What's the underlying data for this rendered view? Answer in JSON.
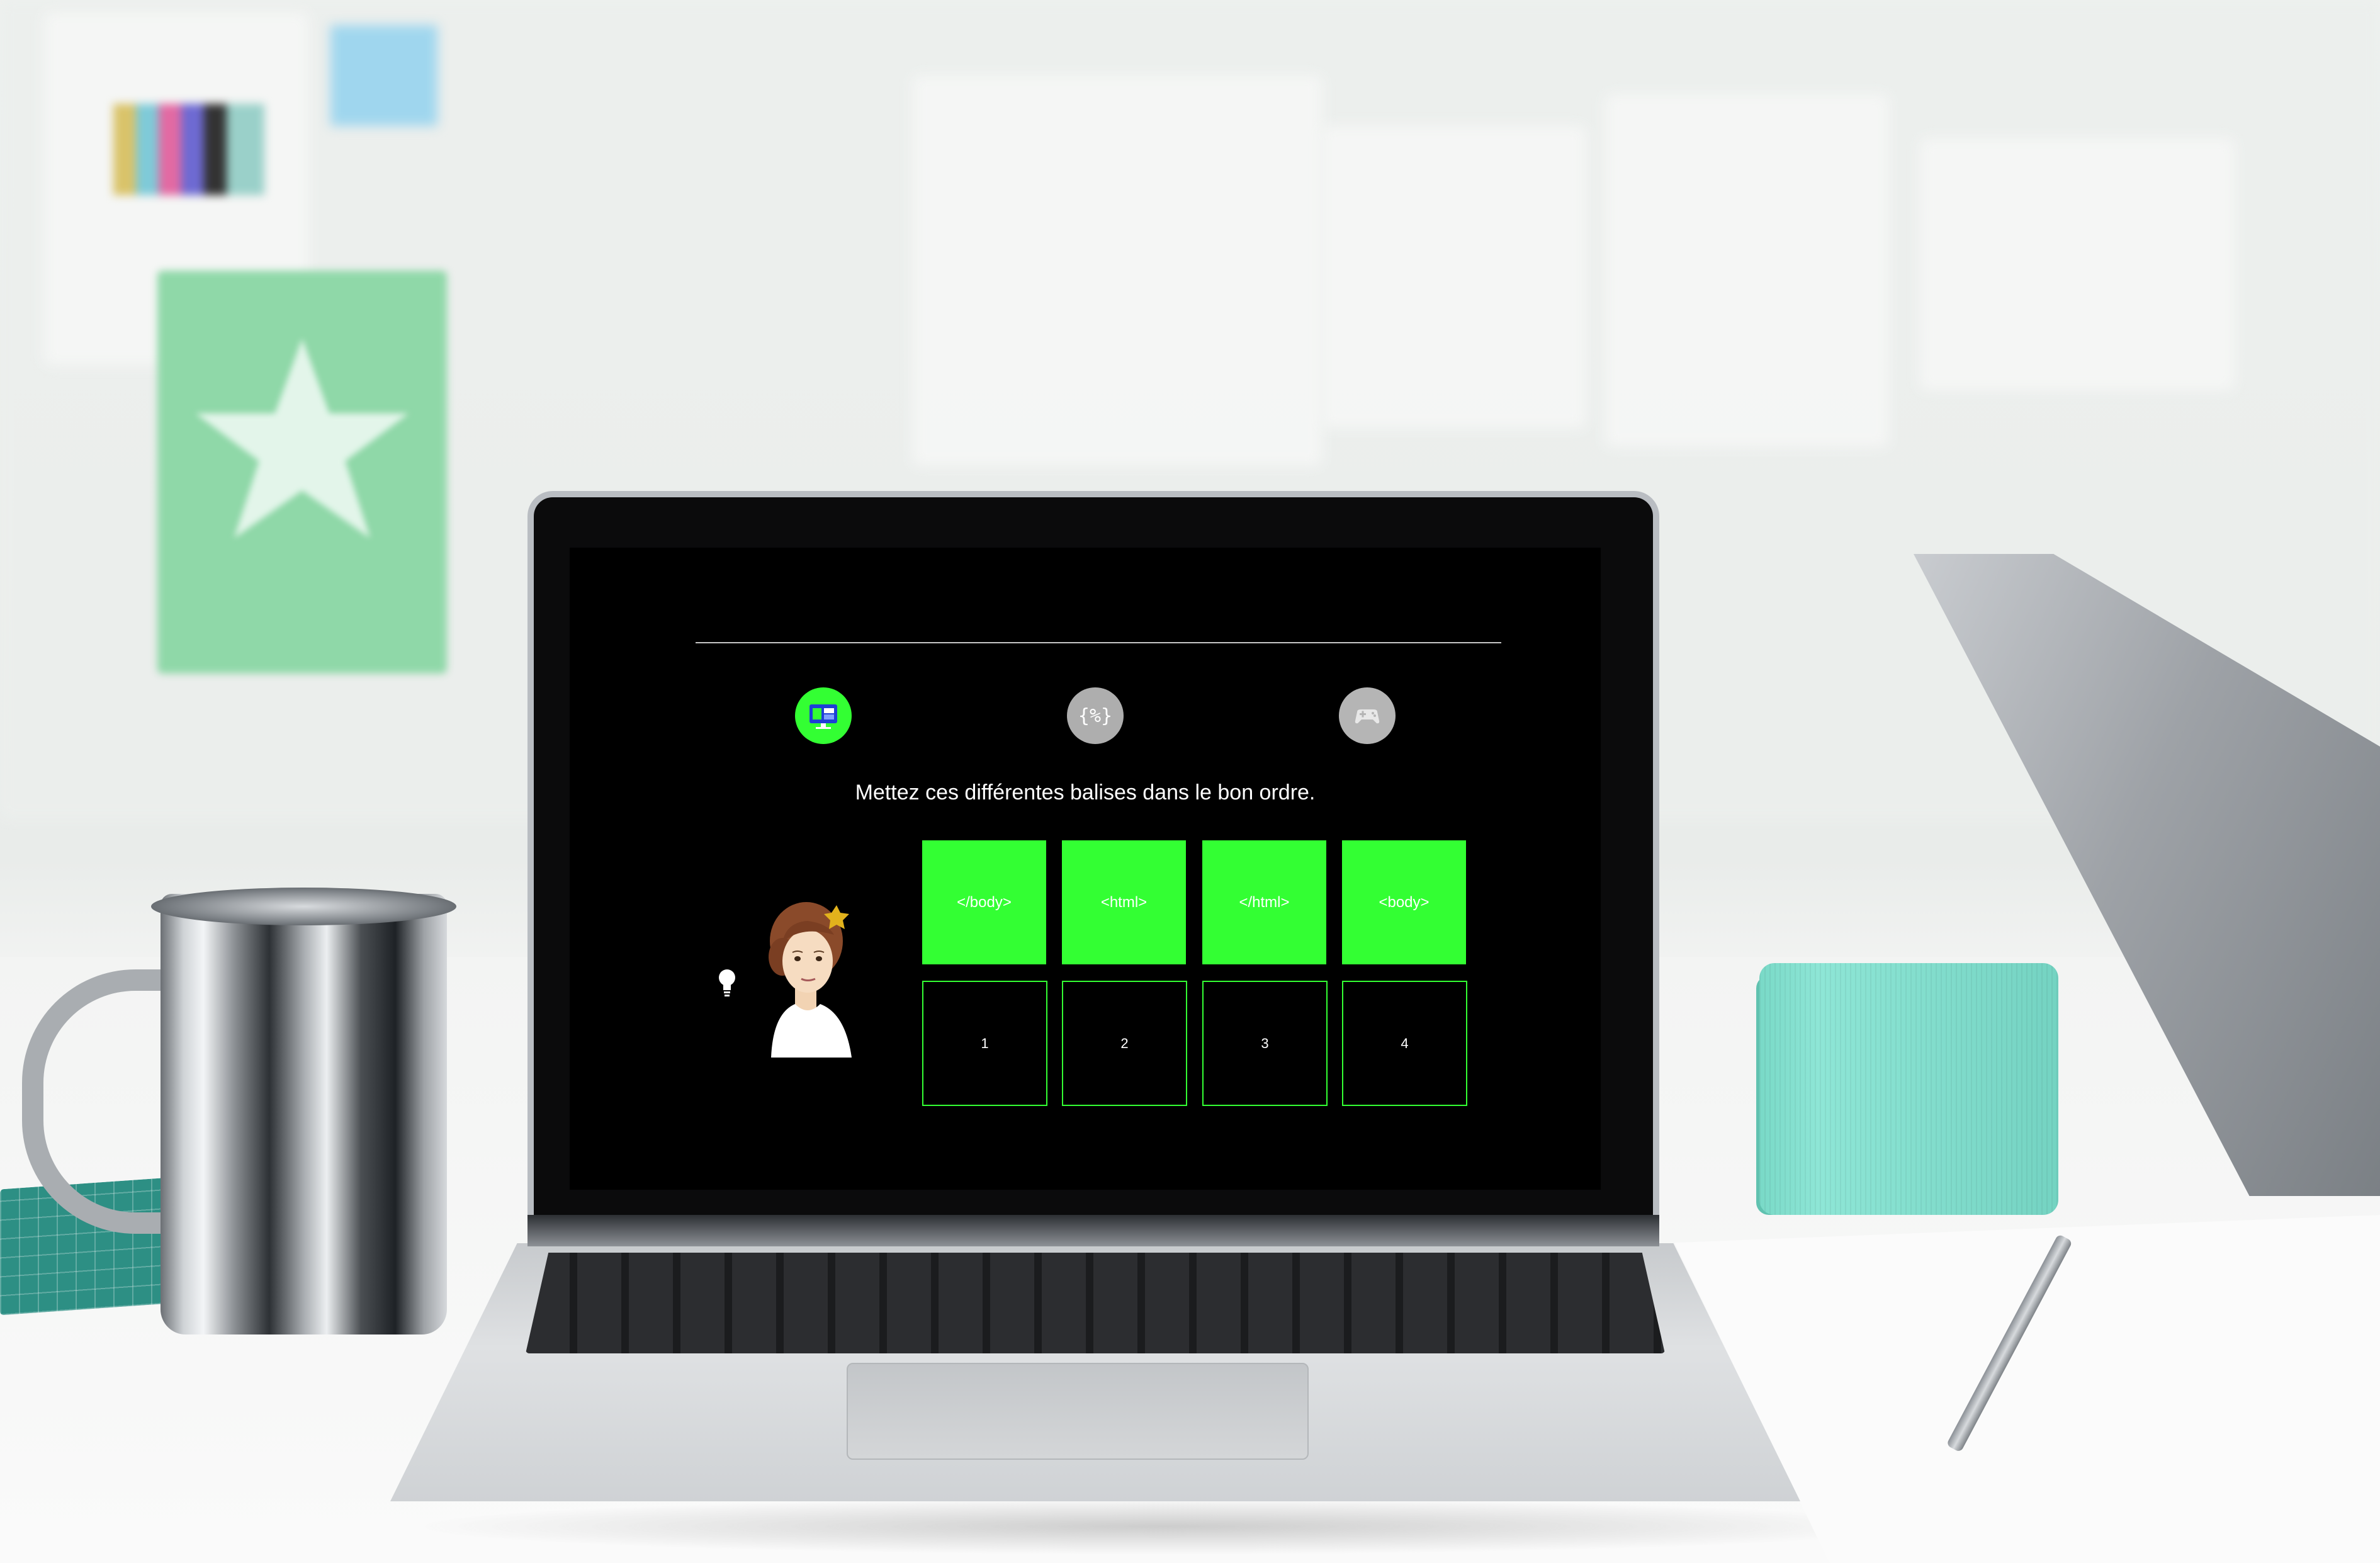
{
  "app": {
    "nav_label": "",
    "steps": [
      {
        "icon": "layout-icon",
        "state": "active"
      },
      {
        "icon": "code-braces-icon",
        "state": "inactive"
      },
      {
        "icon": "gamepad-icon",
        "state": "inactive"
      }
    ],
    "instruction": "Mettez ces différentes balises dans le bon ordre.",
    "tags": [
      "</body>",
      "<html>",
      "</html>",
      "<body>"
    ],
    "slots": [
      "1",
      "2",
      "3",
      "4"
    ],
    "hint_icon": "lightbulb-icon",
    "avatar": "character-avatar",
    "colors": {
      "accent": "#33ff33",
      "background": "#000000",
      "inactive": "#aeaeae"
    }
  }
}
